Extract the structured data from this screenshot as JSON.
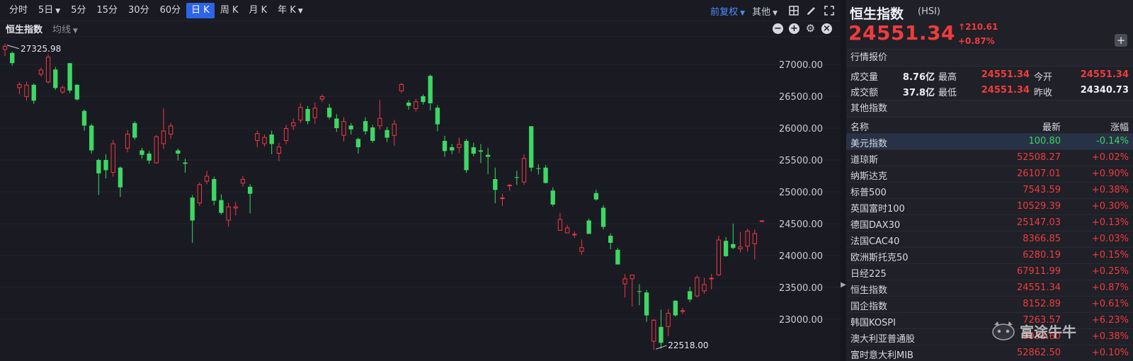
{
  "toolbar": {
    "timeframes": [
      {
        "label": "分时",
        "active": false,
        "caret": false
      },
      {
        "label": "5日",
        "active": false,
        "caret": true
      },
      {
        "label": "5分",
        "active": false,
        "caret": false
      },
      {
        "label": "15分",
        "active": false,
        "caret": false
      },
      {
        "label": "30分",
        "active": false,
        "caret": false
      },
      {
        "label": "60分",
        "active": false,
        "caret": false
      },
      {
        "label": "日 K",
        "active": true,
        "caret": false
      },
      {
        "label": "周 K",
        "active": false,
        "caret": false
      },
      {
        "label": "月 K",
        "active": false,
        "caret": false
      },
      {
        "label": "年 K",
        "active": false,
        "caret": true
      }
    ],
    "adjust_label": "前复权",
    "other_label": "其他",
    "tools": [
      "layout-icon",
      "draw-pen-icon",
      "fullscreen-icon"
    ]
  },
  "subbar": {
    "title": "恒生指数",
    "ma_label": "均线",
    "controls": [
      "zoom-out-icon",
      "zoom-in-icon",
      "settings-icon",
      "close-icon"
    ]
  },
  "chart_data": {
    "type": "candlestick",
    "y_ticks": [
      "27000.00",
      "26500.00",
      "26000.00",
      "25500.00",
      "25000.00",
      "24500.00",
      "24000.00",
      "23500.00",
      "23000.00"
    ],
    "ylim": [
      22500,
      27330
    ],
    "high_marker": "27325.98",
    "low_marker": "22518.00",
    "last_value": 24551.34,
    "colors": {
      "up": "#f23645",
      "down": "#3dd864"
    },
    "candles": [
      [
        27230,
        27290,
        27130,
        27325
      ],
      [
        27180,
        27020,
        26980,
        27200
      ],
      [
        26630,
        26690,
        26530,
        26720
      ],
      [
        26490,
        26680,
        26430,
        26730
      ],
      [
        26680,
        26430,
        26380,
        26700
      ],
      [
        26840,
        26920,
        26810,
        26950
      ],
      [
        26720,
        27120,
        26700,
        27160
      ],
      [
        26920,
        26630,
        26600,
        26960
      ],
      [
        26560,
        26640,
        26540,
        26670
      ],
      [
        27020,
        26590,
        26550,
        27020
      ],
      [
        26680,
        26450,
        26430,
        26690
      ],
      [
        26270,
        26040,
        25960,
        26290
      ],
      [
        26040,
        25650,
        25600,
        26070
      ],
      [
        25500,
        25290,
        24950,
        25520
      ],
      [
        25500,
        25340,
        25210,
        25590
      ],
      [
        25300,
        25760,
        25240,
        25810
      ],
      [
        25380,
        25070,
        24920,
        25400
      ],
      [
        25680,
        25910,
        25620,
        25970
      ],
      [
        26080,
        25850,
        25820,
        26110
      ],
      [
        25650,
        25580,
        25520,
        25690
      ],
      [
        25600,
        25490,
        25440,
        25640
      ],
      [
        25450,
        25870,
        25440,
        25890
      ],
      [
        25750,
        25960,
        25670,
        26310
      ],
      [
        25900,
        26040,
        25830,
        26080
      ],
      [
        25650,
        25600,
        25490,
        25680
      ],
      [
        25460,
        25440,
        25300,
        25520
      ],
      [
        24910,
        24550,
        24200,
        24950
      ],
      [
        24820,
        25120,
        24780,
        25150
      ],
      [
        25160,
        25250,
        25120,
        25330
      ],
      [
        25200,
        24860,
        24790,
        25240
      ],
      [
        24870,
        24670,
        24640,
        24960
      ],
      [
        24550,
        24770,
        24450,
        24830
      ],
      [
        24740,
        24770,
        24630,
        24840
      ],
      [
        25130,
        25200,
        25080,
        25250
      ],
      [
        25080,
        24970,
        24660,
        25120
      ],
      [
        25800,
        25920,
        25700,
        25960
      ],
      [
        25750,
        25860,
        25710,
        25900
      ],
      [
        25900,
        25750,
        25590,
        25960
      ],
      [
        25600,
        25710,
        25480,
        25770
      ],
      [
        25800,
        26000,
        25750,
        26050
      ],
      [
        26030,
        26090,
        25970,
        26150
      ],
      [
        26120,
        26330,
        26080,
        26390
      ],
      [
        26300,
        26110,
        26060,
        26350
      ],
      [
        26160,
        26320,
        26070,
        26400
      ],
      [
        26450,
        26500,
        26410,
        26530
      ],
      [
        26320,
        26170,
        26140,
        26380
      ],
      [
        26150,
        26000,
        25940,
        26220
      ],
      [
        25880,
        26110,
        25790,
        26170
      ],
      [
        26040,
        25980,
        25900,
        26080
      ],
      [
        25830,
        25700,
        25600,
        25850
      ],
      [
        26110,
        25950,
        25900,
        26170
      ],
      [
        26010,
        25800,
        25770,
        26050
      ],
      [
        26030,
        26160,
        25980,
        26440
      ],
      [
        25970,
        25850,
        25780,
        26020
      ],
      [
        25880,
        26070,
        25720,
        26130
      ],
      [
        26580,
        26690,
        26550,
        26710
      ],
      [
        26400,
        26350,
        26290,
        26440
      ],
      [
        26300,
        26420,
        26260,
        26460
      ],
      [
        26500,
        26410,
        26370,
        26530
      ],
      [
        26820,
        26390,
        26280,
        26840
      ],
      [
        26320,
        26060,
        25950,
        26360
      ],
      [
        25800,
        25640,
        25550,
        25880
      ],
      [
        25700,
        25650,
        25590,
        25750
      ],
      [
        25690,
        25750,
        25610,
        25850
      ],
      [
        25800,
        25340,
        25300,
        25830
      ],
      [
        25700,
        25600,
        25560,
        25770
      ],
      [
        25650,
        25630,
        25450,
        25750
      ],
      [
        25580,
        25550,
        25280,
        25690
      ],
      [
        25200,
        25030,
        24820,
        25380
      ],
      [
        24890,
        24910,
        24780,
        24970
      ],
      [
        25100,
        25110,
        25020,
        25120
      ],
      [
        25230,
        25220,
        25110,
        25330
      ],
      [
        25150,
        25530,
        25110,
        25590
      ],
      [
        26030,
        25380,
        25320,
        26030
      ],
      [
        25370,
        25360,
        25270,
        25430
      ],
      [
        25380,
        25140,
        25130,
        25420
      ],
      [
        25020,
        24800,
        24770,
        25070
      ],
      [
        24390,
        24570,
        24420,
        24670
      ],
      [
        24350,
        24440,
        24360,
        24480
      ],
      [
        24330,
        24340,
        24280,
        24380
      ],
      [
        24060,
        24130,
        24010,
        24250
      ],
      [
        24550,
        24340,
        24340,
        24580
      ],
      [
        24980,
        24880,
        24860,
        25030
      ],
      [
        24750,
        24450,
        24410,
        24790
      ],
      [
        24310,
        24200,
        24100,
        24350
      ],
      [
        24090,
        23860,
        23860,
        24120
      ],
      [
        23550,
        23640,
        23340,
        23710
      ],
      [
        23630,
        23700,
        23200,
        23660
      ],
      [
        23440,
        23430,
        23220,
        23550
      ],
      [
        23420,
        23060,
        22960,
        23460
      ],
      [
        22650,
        22990,
        22520,
        23000
      ],
      [
        22880,
        22630,
        22540,
        23150
      ],
      [
        22880,
        23100,
        22730,
        23160
      ],
      [
        23290,
        23060,
        23040,
        23300
      ],
      [
        23120,
        23140,
        23080,
        23180
      ],
      [
        23440,
        23310,
        23270,
        23510
      ],
      [
        23360,
        23660,
        23340,
        23690
      ],
      [
        23440,
        23550,
        23400,
        23650
      ],
      [
        23630,
        23650,
        23470,
        23710
      ],
      [
        23690,
        24250,
        23680,
        24310
      ],
      [
        24230,
        23990,
        23980,
        24290
      ],
      [
        24180,
        24120,
        24100,
        24500
      ],
      [
        24100,
        24140,
        24050,
        24370
      ],
      [
        24140,
        24390,
        24060,
        24420
      ],
      [
        24180,
        24350,
        23940,
        24410
      ],
      [
        24551,
        24551,
        24551,
        24551
      ]
    ]
  },
  "quote": {
    "name": "恒生指数",
    "code": "(HSI)",
    "price": "24551.34",
    "change": "210.61",
    "change_pct": "+0.87%",
    "add_label": "+",
    "section_label": "行情报价",
    "volume_label": "成交量",
    "volume": "8.76亿",
    "high_label": "最高",
    "high": "24551.34",
    "open_label": "今开",
    "open": "24551.34",
    "turnover_label": "成交额",
    "turnover": "37.8亿",
    "low_label": "最低",
    "low": "24551.34",
    "prev_close_label": "昨收",
    "prev_close": "24340.73"
  },
  "other_indices": {
    "section_label": "其他指数",
    "headers": {
      "name": "名称",
      "last": "最新",
      "change": "涨幅"
    },
    "rows": [
      {
        "name": "美元指数",
        "last": "100.80",
        "change": "-0.14%",
        "dir": "dn",
        "selected": true
      },
      {
        "name": "道琼斯",
        "last": "52508.27",
        "change": "+0.02%",
        "dir": "up",
        "selected": false
      },
      {
        "name": "纳斯达克",
        "last": "26107.01",
        "change": "+0.90%",
        "dir": "up",
        "selected": false
      },
      {
        "name": "标普500",
        "last": "7543.59",
        "change": "+0.38%",
        "dir": "up",
        "selected": false
      },
      {
        "name": "英国富时100",
        "last": "10529.39",
        "change": "+0.30%",
        "dir": "up",
        "selected": false
      },
      {
        "name": "德国DAX30",
        "last": "25147.03",
        "change": "+0.13%",
        "dir": "up",
        "selected": false
      },
      {
        "name": "法国CAC40",
        "last": "8366.85",
        "change": "+0.03%",
        "dir": "up",
        "selected": false
      },
      {
        "name": "欧洲斯托克50",
        "last": "6280.19",
        "change": "+0.15%",
        "dir": "up",
        "selected": false
      },
      {
        "name": "日经225",
        "last": "67911.99",
        "change": "+0.25%",
        "dir": "up",
        "selected": false
      },
      {
        "name": "恒生指数",
        "last": "24551.34",
        "change": "+0.87%",
        "dir": "up",
        "selected": false
      },
      {
        "name": "国企指数",
        "last": "8152.89",
        "change": "+0.61%",
        "dir": "up",
        "selected": false
      },
      {
        "name": "韩国KOSPI",
        "last": "7263.57",
        "change": "+6.23%",
        "dir": "up",
        "selected": false
      },
      {
        "name": "澳大利亚普通股",
        "last": "9033.60",
        "change": "+0.38%",
        "dir": "up",
        "selected": false
      },
      {
        "name": "富时意大利MIB",
        "last": "52862.50",
        "change": "+0.10%",
        "dir": "up",
        "selected": false
      }
    ]
  },
  "watermark": {
    "text": "富途牛牛"
  }
}
